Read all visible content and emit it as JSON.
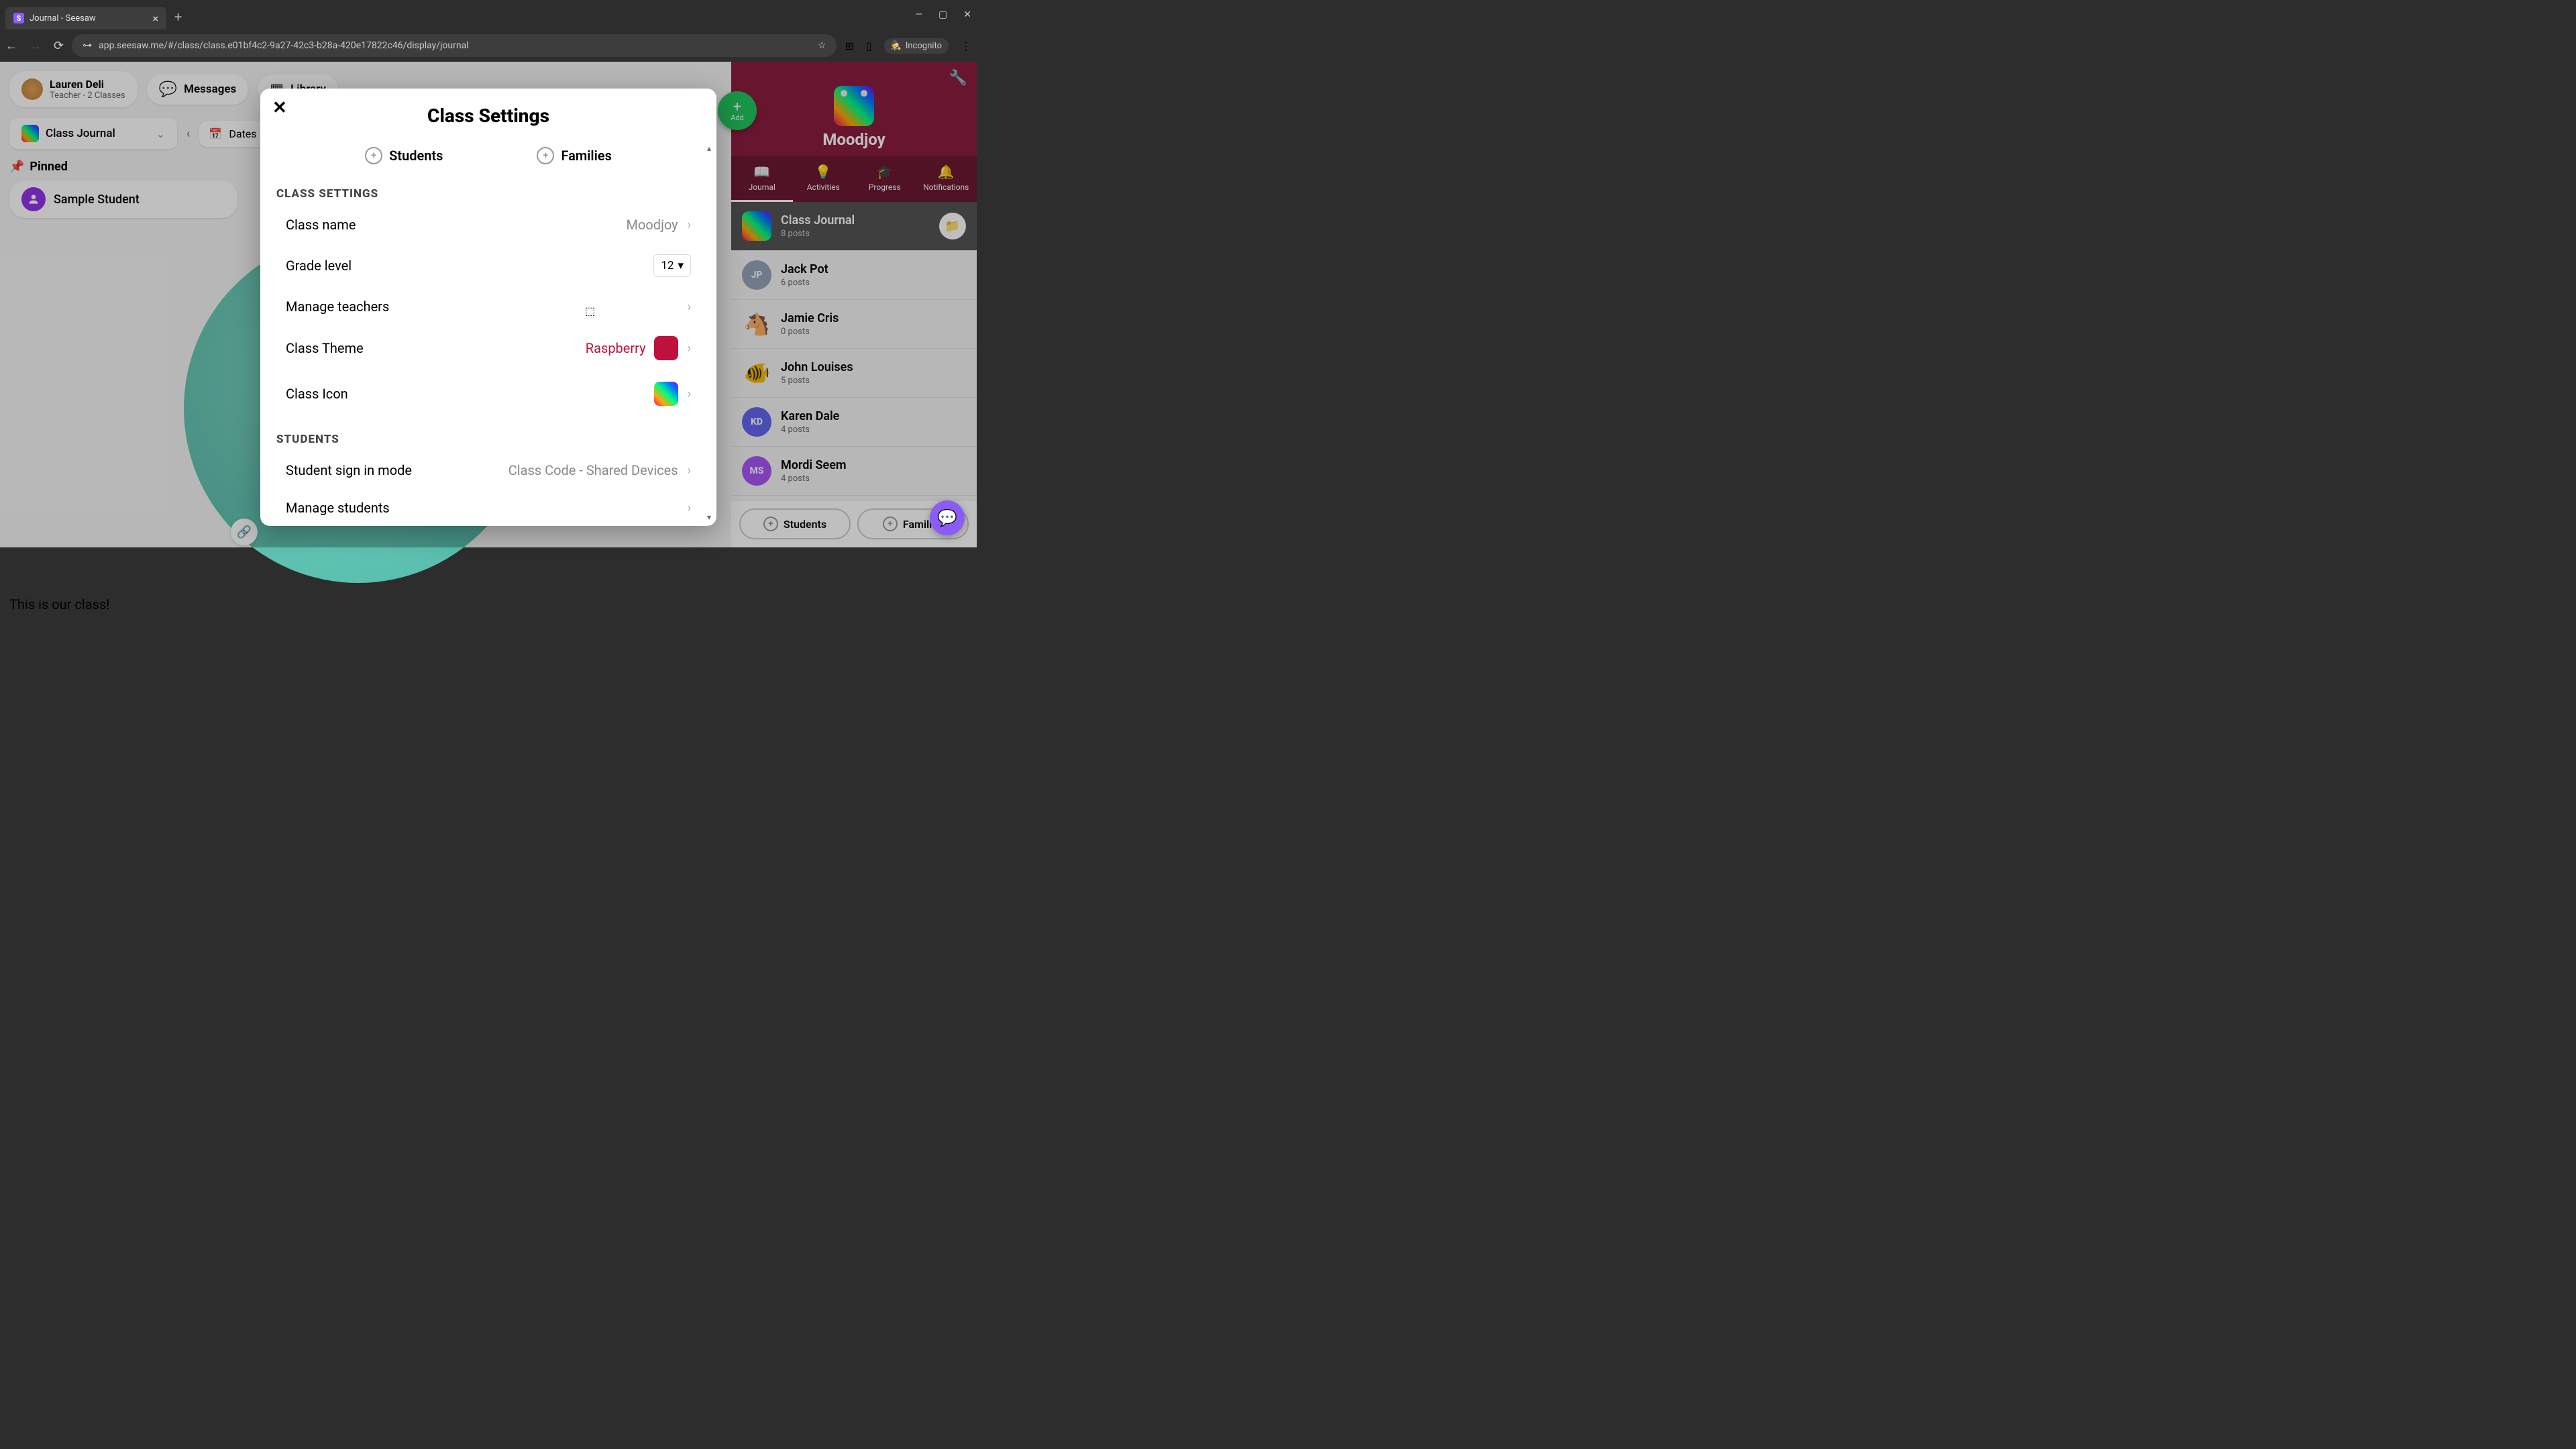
{
  "browser": {
    "tab_title": "Journal - Seesaw",
    "url": "app.seesaw.me/#/class/class.e01bf4c2-9a27-42c3-b28a-420e17822c46/display/journal",
    "incognito_label": "Incognito"
  },
  "user": {
    "name": "Lauren Deli",
    "role": "Teacher - 2 Classes"
  },
  "top_nav": {
    "messages": "Messages",
    "library": "Library"
  },
  "journal": {
    "selector_label": "Class Journal",
    "dates_label": "Dates"
  },
  "pinned": {
    "header": "Pinned",
    "student": "Sample Student"
  },
  "post_caption": "This is our class!",
  "add_button": "Add",
  "class_header": {
    "name": "Moodjoy"
  },
  "tabs": {
    "journal": "Journal",
    "activities": "Activities",
    "progress": "Progress",
    "notifications": "Notifications"
  },
  "folders": [
    {
      "name": "Class Journal",
      "sub": "8 posts",
      "has_badge": true,
      "active": true,
      "icon_type": "rainbow"
    },
    {
      "name": "Jack Pot",
      "sub": "6 posts",
      "icon_type": "letter",
      "initials": "JP",
      "cls": "jp"
    },
    {
      "name": "Jamie Cris",
      "sub": "0 posts",
      "icon_type": "emoji",
      "emoji": "🐴"
    },
    {
      "name": "John Louises",
      "sub": "5 posts",
      "icon_type": "emoji",
      "emoji": "🐠"
    },
    {
      "name": "Karen Dale",
      "sub": "4 posts",
      "icon_type": "letter",
      "initials": "KD",
      "cls": "kd"
    },
    {
      "name": "Mordi Seem",
      "sub": "4 posts",
      "icon_type": "letter",
      "initials": "MS",
      "cls": "ms"
    }
  ],
  "bottom_pills": {
    "students": "Students",
    "families": "Families"
  },
  "modal": {
    "title": "Class Settings",
    "tab_students": "Students",
    "tab_families": "Families",
    "section_class": "CLASS SETTINGS",
    "section_students": "STUDENTS",
    "rows": {
      "class_name": {
        "label": "Class name",
        "value": "Moodjoy"
      },
      "grade": {
        "label": "Grade level",
        "value": "12"
      },
      "teachers": {
        "label": "Manage teachers"
      },
      "theme": {
        "label": "Class Theme",
        "value": "Raspberry"
      },
      "icon": {
        "label": "Class Icon"
      },
      "signin": {
        "label": "Student sign in mode",
        "value": "Class Code - Shared Devices"
      },
      "manage_students": {
        "label": "Manage students"
      }
    }
  }
}
